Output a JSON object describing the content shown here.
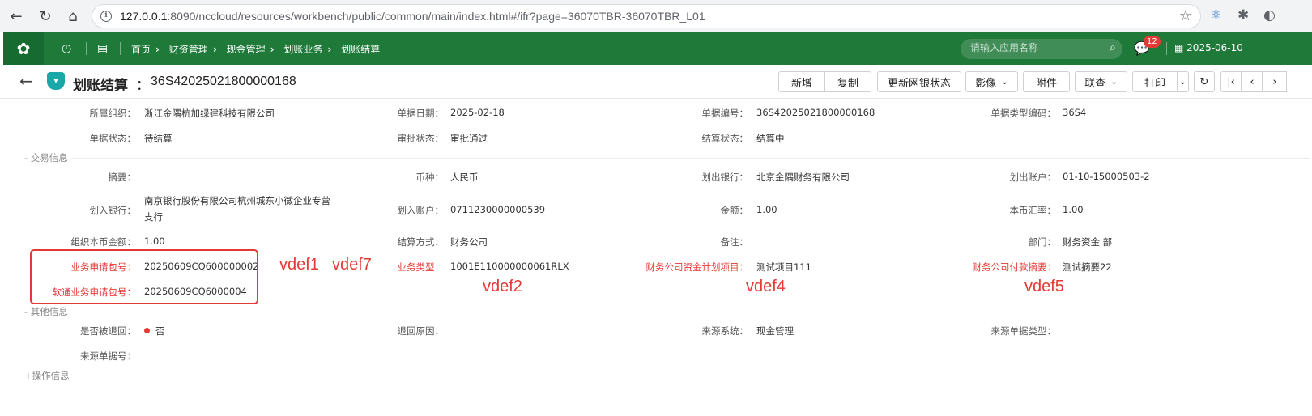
{
  "browser": {
    "url_host": "127.0.0.1",
    "url_rest": ":8090/nccloud/resources/workbench/public/common/main/index.html#/ifr?page=36070TBR-36070TBR_L01"
  },
  "header": {
    "breadcrumbs": [
      "首页",
      "财资管理",
      "现金管理",
      "划账业务",
      "划账结算"
    ],
    "search_placeholder": "请输入应用名称",
    "message_count": "12",
    "date": "2025-06-10"
  },
  "titlebar": {
    "title": "划账结算",
    "colon": "：",
    "code": "36S42025021800000168",
    "buttons": {
      "add": "新增",
      "copy": "复制",
      "update_bank": "更新网银状态",
      "image": "影像",
      "attachment": "附件",
      "link": "联查",
      "print": "打印"
    }
  },
  "form": {
    "org_label": "所属组织：",
    "org_value": "浙江金隅杭加绿建科技有限公司",
    "date_label": "单据日期：",
    "date_value": "2025-02-18",
    "billno_label": "单据编号：",
    "billno_value": "36S42025021800000168",
    "billtype_label": "单据类型编码：",
    "billtype_value": "36S4",
    "status_label": "单据状态：",
    "status_value": "待结算",
    "approve_label": "审批状态：",
    "approve_value": "审批通过",
    "settle_status_label": "结算状态：",
    "settle_status_value": "结算中",
    "section_trade": "- 交易信息",
    "summary_label": "摘要：",
    "currency_label": "币种：",
    "currency_value": "人民币",
    "outbank_label": "划出银行：",
    "outbank_value": "北京金隅财务有限公司",
    "outacct_label": "划出账户：",
    "outacct_value": "01-10-15000503-2",
    "inbank_label": "划入银行：",
    "inbank_value": "南京银行股份有限公司杭州城东小微企业专营支行",
    "inacct_label": "划入账户：",
    "inacct_value": "0711230000000539",
    "amount_label": "金额：",
    "amount_value": "1.00",
    "rate_label": "本币汇率：",
    "rate_value": "1.00",
    "orgamount_label": "组织本币金额：",
    "orgamount_value": "1.00",
    "settle_method_label": "结算方式：",
    "settle_method_value": "财务公司",
    "remark_label": "备注：",
    "dept_label": "部门：",
    "dept_value": "财务资金 部",
    "bizpkg_label": "业务申请包号：",
    "bizpkg_value": "20250609CQ600000002",
    "bizpkg2_label": "软通业务申请包号：",
    "bizpkg2_value": "20250609CQ6000004",
    "biztype_label": "业务类型：",
    "biztype_value": "1001E110000000061RLX",
    "plan_label": "财务公司资金计划项目：",
    "plan_value": "测试项目111",
    "paysum_label": "财务公司付款摘要：",
    "paysum_value": "测试摘要22",
    "section_other": "- 其他信息",
    "returned_label": "是否被退回：",
    "returned_value": "否",
    "return_reason_label": "退回原因：",
    "source_sys_label": "来源系统：",
    "source_sys_value": "现金管理",
    "source_type_label": "来源单据类型：",
    "source_no_label": "来源单据号：",
    "section_ops": "+操作信息"
  },
  "annotations": {
    "a1": "vdef1",
    "a2": "vdef7",
    "a3": "vdef2",
    "a4": "vdef4",
    "a5": "vdef5"
  },
  "colors": {
    "header_green": "#1f7a3a",
    "annotation_red": "#e53935"
  }
}
